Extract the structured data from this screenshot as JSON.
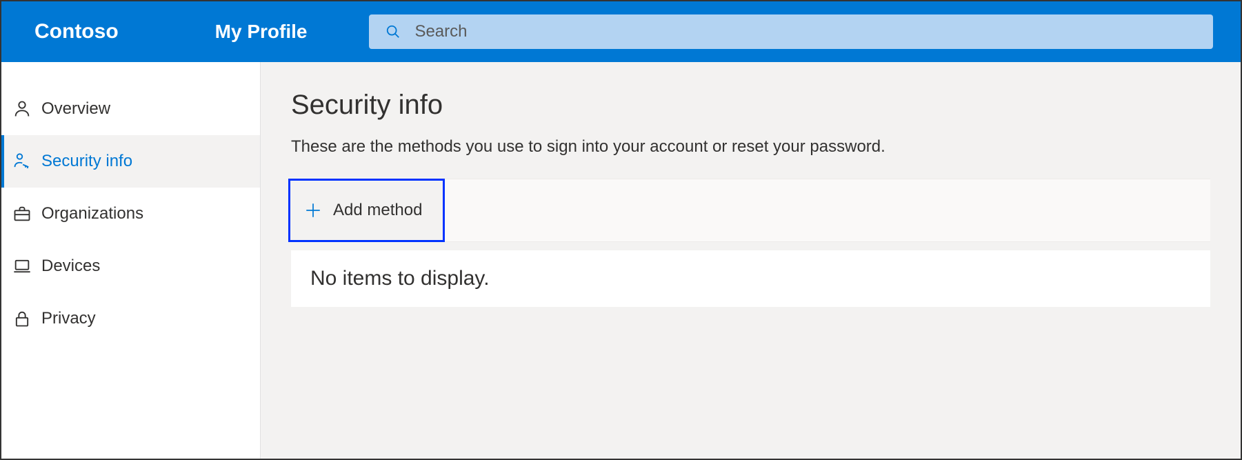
{
  "header": {
    "brand": "Contoso",
    "profile_title": "My Profile",
    "search_placeholder": "Search"
  },
  "sidebar": {
    "items": [
      {
        "label": "Overview",
        "icon": "person-icon",
        "active": false
      },
      {
        "label": "Security info",
        "icon": "key-person-icon",
        "active": true
      },
      {
        "label": "Organizations",
        "icon": "briefcase-icon",
        "active": false
      },
      {
        "label": "Devices",
        "icon": "laptop-icon",
        "active": false
      },
      {
        "label": "Privacy",
        "icon": "lock-icon",
        "active": false
      }
    ]
  },
  "main": {
    "title": "Security info",
    "subtitle": "These are the methods you use to sign into your account or reset your password.",
    "add_method_label": "Add method",
    "empty_message": "No items to display."
  }
}
